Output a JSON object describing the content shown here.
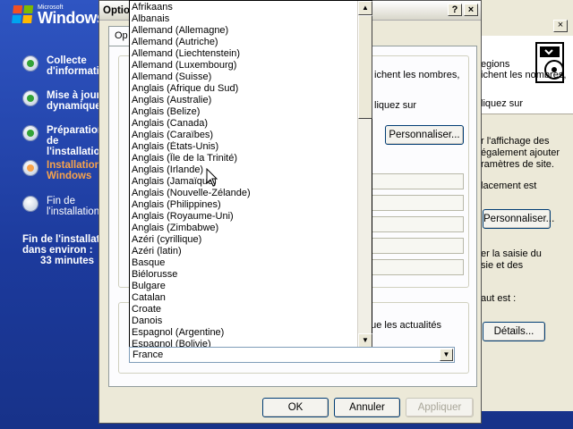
{
  "setup": {
    "logo": {
      "company": "Microsoft",
      "product": "Windows"
    },
    "steps": [
      {
        "label": "Collecte d'informations",
        "state": "done"
      },
      {
        "label": "Mise à jour dynamique",
        "state": "done"
      },
      {
        "label": "Préparation de l'installation",
        "state": "done"
      },
      {
        "label": "Installation de Windows",
        "state": "current"
      },
      {
        "label": "Fin de l'installation",
        "state": "pending"
      }
    ],
    "eta": {
      "line1": "Fin de l'installation",
      "line2": "dans environ :",
      "minutes": "33 minutes"
    }
  },
  "regional_dialog": {
    "banner_text": "egions",
    "close_label": "×",
    "text_1": "ichent les nombres,",
    "text_2": "liquez sur",
    "text_3": "r l'affichage des",
    "text_4": "également ajouter",
    "text_5": "ramètres de site.",
    "text_6": "lacement est",
    "text_7": "er la saisie du",
    "text_8": "sie et des",
    "text_9": "aut est :",
    "text_10": "que les actualités",
    "button_customize_1": "Personnaliser...",
    "button_customize_2": "Personnaliser...",
    "button_details": "Détails...",
    "button_apply": "Appliquer"
  },
  "options_dialog": {
    "title": "Optio",
    "tab_label": "Op",
    "help_label": "?",
    "close_label": "×",
    "button_ok": "OK",
    "button_cancel": "Annuler"
  },
  "language_list": {
    "items": [
      "Afrikaans",
      "Albanais",
      "Allemand (Allemagne)",
      "Allemand (Autriche)",
      "Allemand (Liechtenstein)",
      "Allemand (Luxembourg)",
      "Allemand (Suisse)",
      "Anglais (Afrique du Sud)",
      "Anglais (Australie)",
      "Anglais (Belize)",
      "Anglais (Canada)",
      "Anglais (Caraïbes)",
      "Anglais (États-Unis)",
      "Anglais (Île de la Trinité)",
      "Anglais (Irlande)",
      "Anglais (Jamaïque)",
      "Anglais (Nouvelle-Zélande)",
      "Anglais (Philippines)",
      "Anglais (Royaume-Uni)",
      "Anglais (Zimbabwe)",
      "Azéri (cyrillique)",
      "Azéri (latin)",
      "Basque",
      "Biélorusse",
      "Bulgare",
      "Catalan",
      "Croate",
      "Danois",
      "Espagnol (Argentine)",
      "Espagnol (Bolivie)"
    ],
    "selected_value": "France",
    "scroll_position": 0.0
  },
  "colors": {
    "desktop_blue": "#1f3f9e",
    "step_done": "#33a238",
    "step_current": "#f7a34b",
    "dialog_face": "#ece9d8"
  }
}
